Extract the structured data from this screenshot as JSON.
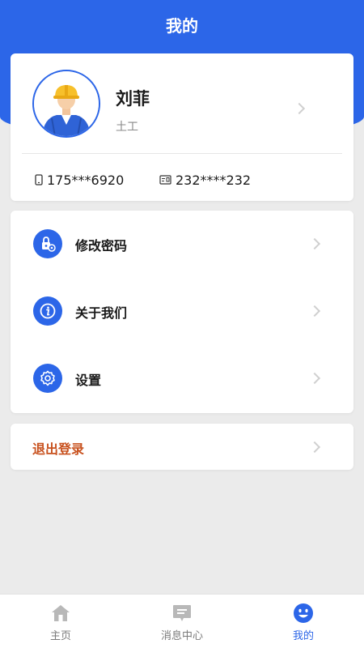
{
  "header": {
    "title": "我的"
  },
  "profile": {
    "name": "刘菲",
    "role": "土工",
    "phone": "175***6920",
    "id_number": "232****232"
  },
  "menu": {
    "items": [
      {
        "label": "修改密码",
        "icon": "lock-gear-icon"
      },
      {
        "label": "关于我们",
        "icon": "info-icon"
      },
      {
        "label": "设置",
        "icon": "gear-icon"
      }
    ]
  },
  "logout": {
    "label": "退出登录"
  },
  "tabbar": {
    "tabs": [
      {
        "label": "主页",
        "icon": "home-icon",
        "active": false
      },
      {
        "label": "消息中心",
        "icon": "message-icon",
        "active": false
      },
      {
        "label": "我的",
        "icon": "smile-icon",
        "active": true
      }
    ]
  },
  "colors": {
    "primary": "#2c66e8",
    "logout_text": "#c8521f",
    "background": "#ebebeb",
    "inactive_tab": "#7a7a7a"
  }
}
